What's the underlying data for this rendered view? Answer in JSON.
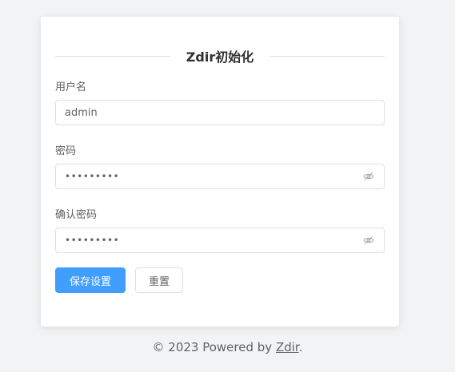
{
  "form": {
    "title": "Zdir初始化",
    "username_label": "用户名",
    "username_value": "admin",
    "password_label": "密码",
    "password_value": "•••••••••",
    "confirm_label": "确认密码",
    "confirm_value": "•••••••••",
    "save_label": "保存设置",
    "reset_label": "重置"
  },
  "footer": {
    "prefix": "© 2023 Powered by ",
    "link_text": "Zdir",
    "suffix": "."
  },
  "colors": {
    "primary": "#409eff",
    "background": "#f2f3f5",
    "border": "#dcdfe6"
  },
  "icons": {
    "password_toggle": "eye-slash-icon"
  }
}
